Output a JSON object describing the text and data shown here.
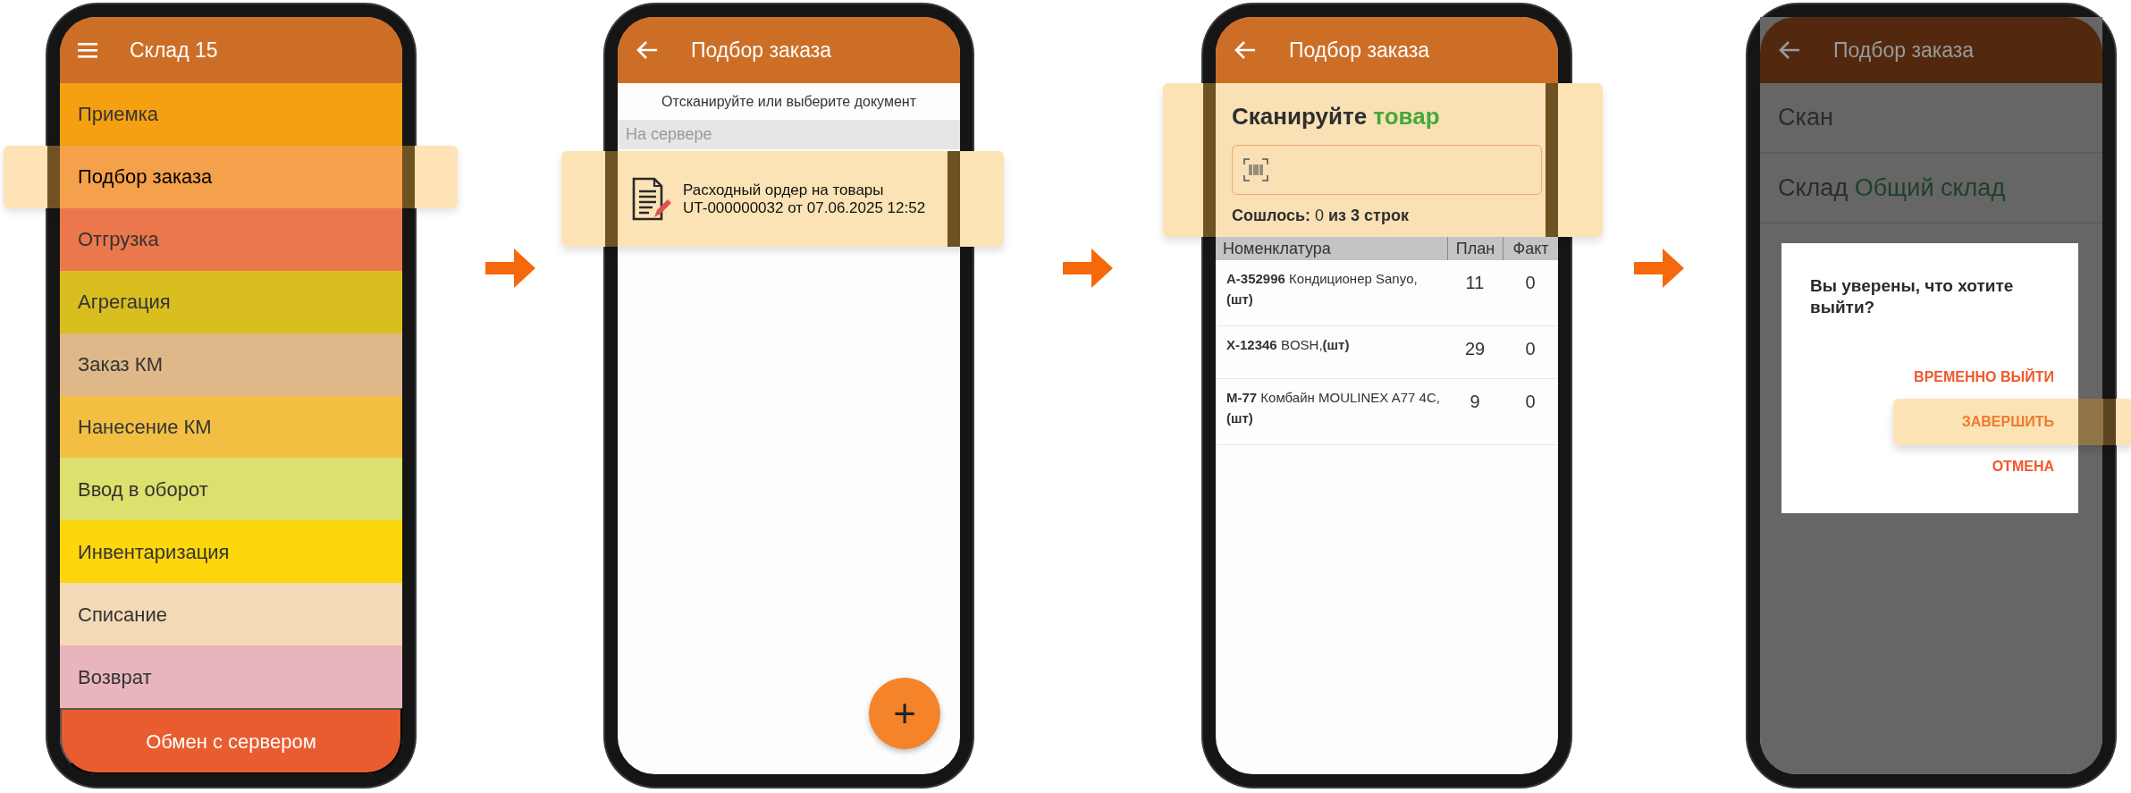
{
  "screens": [
    {
      "kind": "menu",
      "title": "Склад 15",
      "items": [
        {
          "label": "Приемка",
          "color": "#f4a010",
          "selected": false
        },
        {
          "label": "Подбор заказа",
          "color": "#f5a04a",
          "selected": true
        },
        {
          "label": "Отгрузка",
          "color": "#eb774c",
          "selected": false
        },
        {
          "label": "Агрегация",
          "color": "#d9be20",
          "selected": false
        },
        {
          "label": "Заказ КМ",
          "color": "#dfb889",
          "selected": false
        },
        {
          "label": "Нанесение КМ",
          "color": "#f3bf43",
          "selected": false
        },
        {
          "label": "Ввод в оборот",
          "color": "#dce06c",
          "selected": false
        },
        {
          "label": "Инвентаризация",
          "color": "#fdd60c",
          "selected": false
        },
        {
          "label": "Списание",
          "color": "#f3d9b5",
          "selected": false
        },
        {
          "label": "Возврат",
          "color": "#e9b5bd",
          "selected": false
        }
      ],
      "footer_button": "Обмен с сервером"
    },
    {
      "kind": "documents",
      "title": "Подбор заказа",
      "hint": "Отсканируйте или выберите документ",
      "section": "На сервере",
      "documents": [
        {
          "title": "Расходный ордер на товары",
          "subtitle": "UT-000000032 от 07.06.2025 12:52",
          "selected": true
        }
      ],
      "fab": "+"
    },
    {
      "kind": "scan",
      "title": "Подбор заказа",
      "prompt": "Сканируйте",
      "prompt_object": "товар",
      "highlighted": true,
      "matched": "**Сошлось:** 0 **из 3 строк**",
      "columns": [
        "Номенклатура",
        "План",
        "Факт"
      ],
      "rows": [
        {
          "item": "**А-352996** Кондиционер Sanyo, **(шт)**",
          "plan": "11",
          "fact": "0"
        },
        {
          "item": "**X-12346** BOSH,**(шт)**",
          "plan": "29",
          "fact": "0"
        },
        {
          "item": "**М-77** Комбайн MOULINEX A77 4C, **(шт)**",
          "plan": "9",
          "fact": "0"
        }
      ]
    },
    {
      "kind": "dialog",
      "title": "Подбор заказа",
      "fields": [
        {
          "label": "Скан"
        },
        {
          "label": "Склад",
          "value": "Общий склад"
        }
      ],
      "dialog": {
        "message": "Вы уверены, что хотите выйти?",
        "buttons": [
          {
            "label": "ВРЕМЕННО ВЫЙТИ",
            "selected": false
          },
          {
            "label": "ЗАВЕРШИТЬ",
            "selected": true
          },
          {
            "label": "ОТМЕНА",
            "selected": false
          }
        ]
      }
    }
  ]
}
